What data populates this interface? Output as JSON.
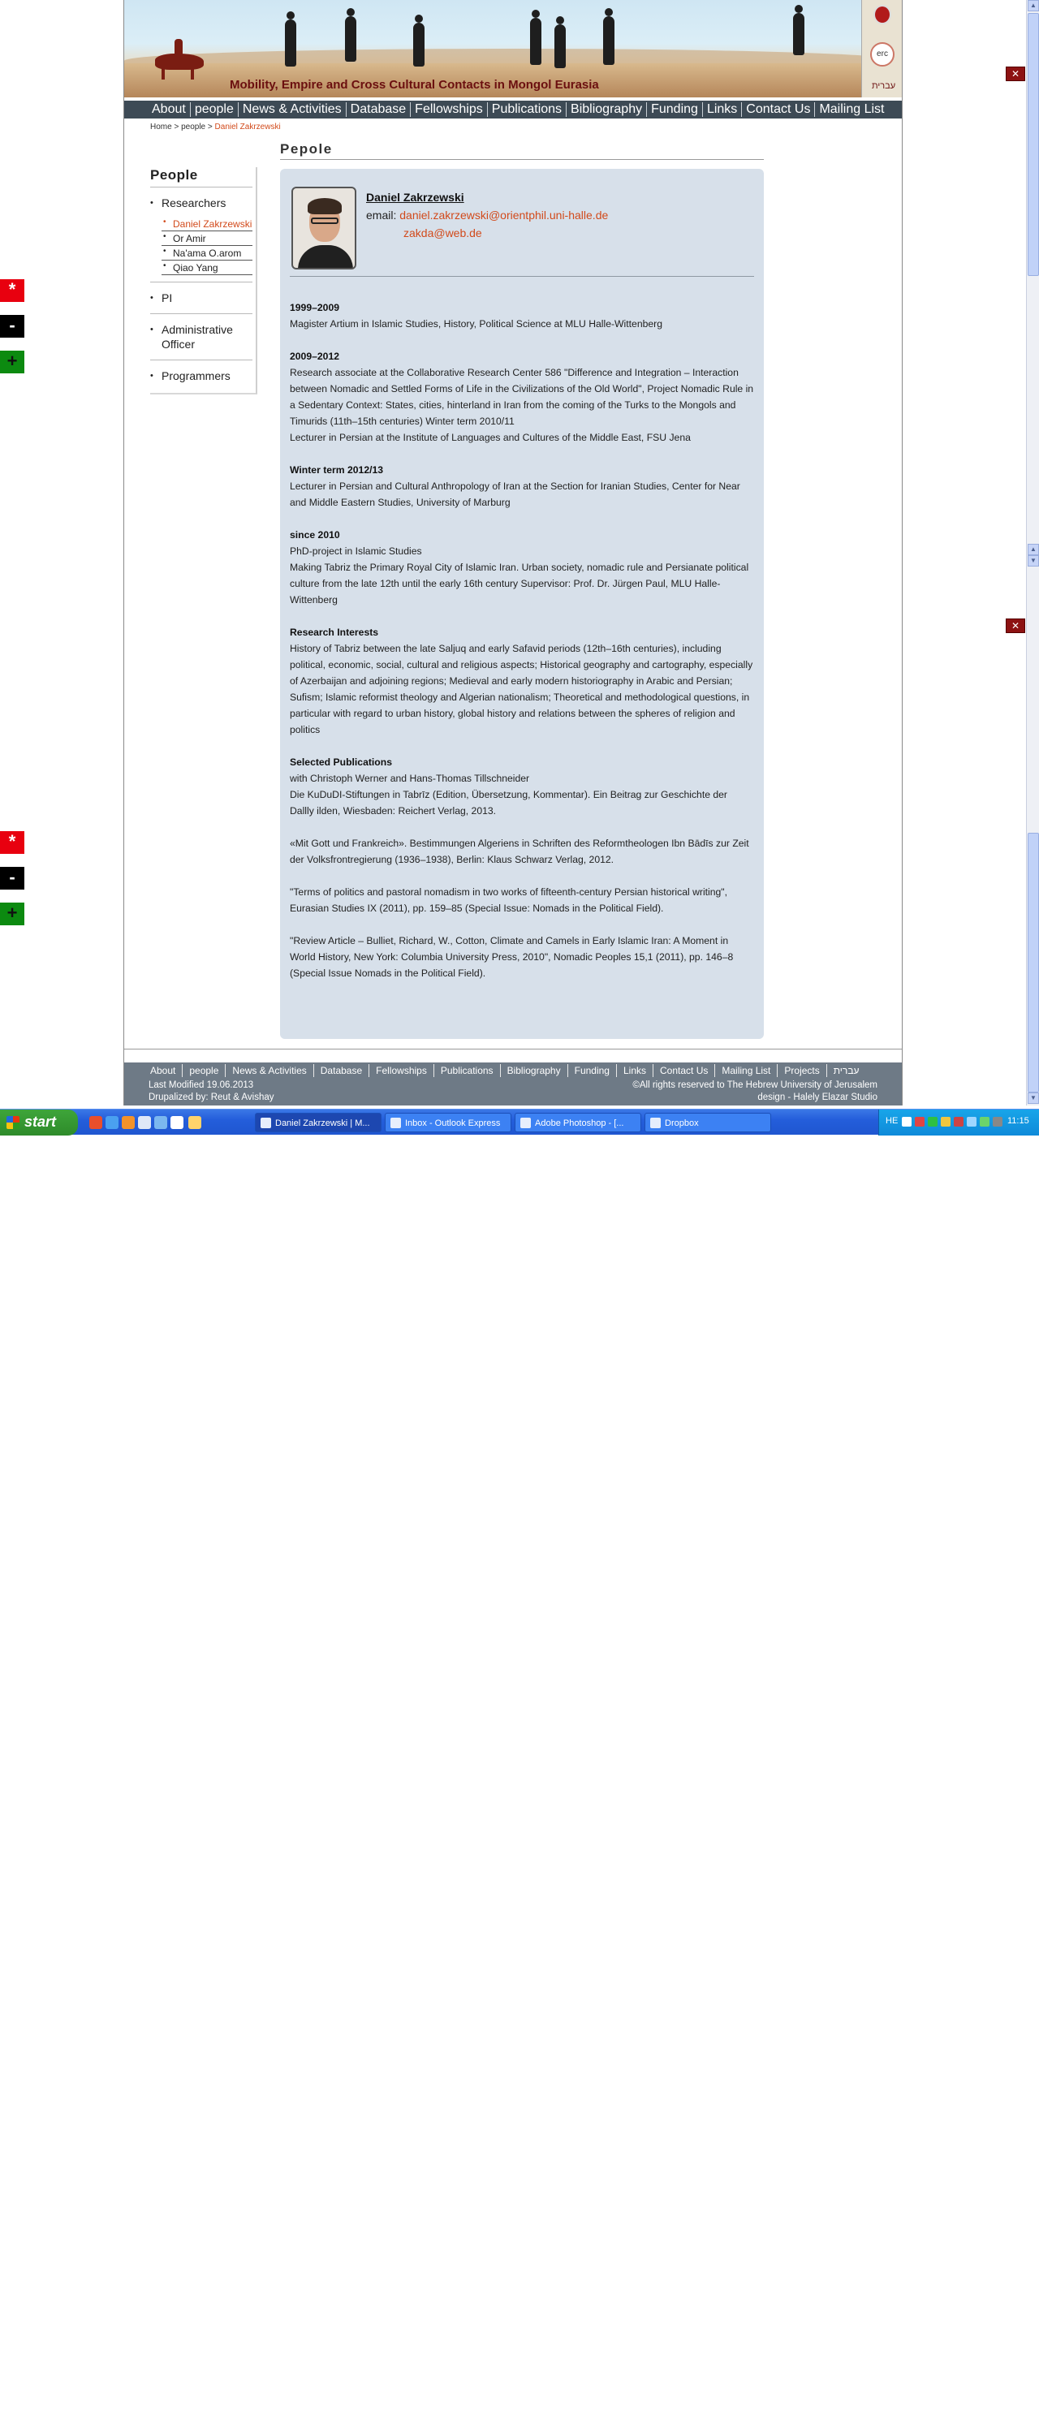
{
  "header": {
    "site_title": "Mobility, Empire and Cross Cultural Contacts in Mongol Eurasia",
    "hebrew_link": "עברית",
    "erc_logo_text": "erc"
  },
  "nav": [
    "About",
    "people",
    "News & Activities",
    "Database",
    "Fellowships",
    "Publications",
    "Bibliography",
    "Funding",
    "Links",
    "Contact Us",
    "Mailing List"
  ],
  "breadcrumb": {
    "home": "Home",
    "sep1": ">",
    "people": "people",
    "sep2": ">",
    "current": "Daniel Zakrzewski"
  },
  "sidebar": {
    "title": "People",
    "researchers": "Researchers",
    "sub_items": [
      "Daniel Zakrzewski",
      "Or Amir",
      "Na'ama O.arom",
      "Qiao Yang"
    ],
    "pi": "PI",
    "admin": "Administrative Officer",
    "programmers": "Programmers"
  },
  "main": {
    "title": "Pepole",
    "name": "Daniel Zakrzewski",
    "email_label": "email:",
    "email1": "daniel.zakrzewski@orientphil.uni-halle.de",
    "email2": "zakda@web.de",
    "sections": [
      {
        "head": "1999–2009",
        "lines": [
          "Magister Artium in Islamic Studies, History, Political Science at MLU Halle-Wittenberg"
        ]
      },
      {
        "head": "2009–2012",
        "lines": [
          "Research associate at the Collaborative Research Center 586 \"Difference and Integration – Interaction between Nomadic and Settled Forms of Life in the Civilizations of the Old World\", Project Nomadic Rule in a Sedentary Context: States, cities, hinterland in Iran from the coming of the Turks to the Mongols and Timurids (11th–15th centuries) Winter term 2010/11",
          "Lecturer in Persian at the Institute of Languages and Cultures of the Middle East, FSU Jena"
        ]
      },
      {
        "head": "Winter term 2012/13",
        "lines": [
          "Lecturer in Persian and Cultural Anthropology of Iran at the Section for Iranian Studies, Center for Near and Middle Eastern Studies, University of Marburg"
        ]
      },
      {
        "head": "since 2010",
        "lines": [
          "PhD-project in Islamic Studies",
          "Making Tabriz the Primary Royal City of Islamic Iran. Urban society, nomadic rule and Persianate political culture from the late 12th until the early 16th century Supervisor: Prof. Dr. Jürgen Paul, MLU Halle-Wittenberg"
        ]
      },
      {
        "head": "Research Interests",
        "lines": [
          "History of Tabriz between the late Saljuq and early Safavid periods (12th–16th centuries), including political, economic, social, cultural and religious aspects; Historical geography and cartography, especially of Azerbaijan and adjoining regions; Medieval and early modern historiography in Arabic and Persian; Sufism; Islamic reformist theology and Algerian nationalism; Theoretical and methodological questions, in particular with regard to urban history, global history and relations between the spheres of religion and politics"
        ]
      }
    ],
    "pubs_head": "Selected Publications",
    "pubs_intro": [
      "with Christoph Werner and Hans-Thomas Tillschneider",
      "Die KuDuDI-Stiftungen in Tabrīz (Edition, Übersetzung, Kommentar). Ein Beitrag zur Geschichte der Dallly ilden, Wiesbaden: Reichert Verlag, 2013."
    ],
    "pubs": [
      "«Mit Gott und Frankreich». Bestimmungen Algeriens in Schriften des Reformtheologen Ibn Bādīs zur Zeit der Volksfrontregierung (1936–1938), Berlin: Klaus Schwarz Verlag, 2012.",
      "\"Terms of politics and pastoral nomadism in two works of fifteenth-century Persian historical writing\", Eurasian Studies IX (2011), pp. 159–85 (Special Issue: Nomads in the Political Field).",
      "\"Review Article – Bulliet, Richard, W., Cotton, Climate and Camels in Early Islamic Iran: A Moment in World History, New York: Columbia University Press, 2010\", Nomadic Peoples 15,1 (2011), pp. 146–8 (Special Issue Nomads in the Political Field)."
    ]
  },
  "footer": {
    "nav": [
      "About",
      "people",
      "News & Activities",
      "Database",
      "Fellowships",
      "Publications",
      "Bibliography",
      "Funding",
      "Links",
      "Contact Us",
      "Mailing List",
      "Projects",
      "עברית"
    ],
    "last_modified": "Last Modified 19.06.2013",
    "drupalized": "Drupalized by: Reut & Avishay",
    "rights": "©All rights reserved to The Hebrew University of Jerusalem",
    "design": "design - Halely Elazar Studio"
  },
  "widgets": {
    "star": "*",
    "minus": "-",
    "plus": "+"
  },
  "taskbar": {
    "start": "start",
    "tasks": [
      "Daniel Zakrzewski | M...",
      "Inbox - Outlook Express",
      "Adobe Photoshop - [...",
      "Dropbox"
    ],
    "lang": "HE",
    "clock": "11:15"
  },
  "colors": {
    "accent": "#d24a1b",
    "nav_bg": "#3d4a55",
    "content_bg": "#d7e0ea",
    "footer_bg": "#6e7a86"
  }
}
